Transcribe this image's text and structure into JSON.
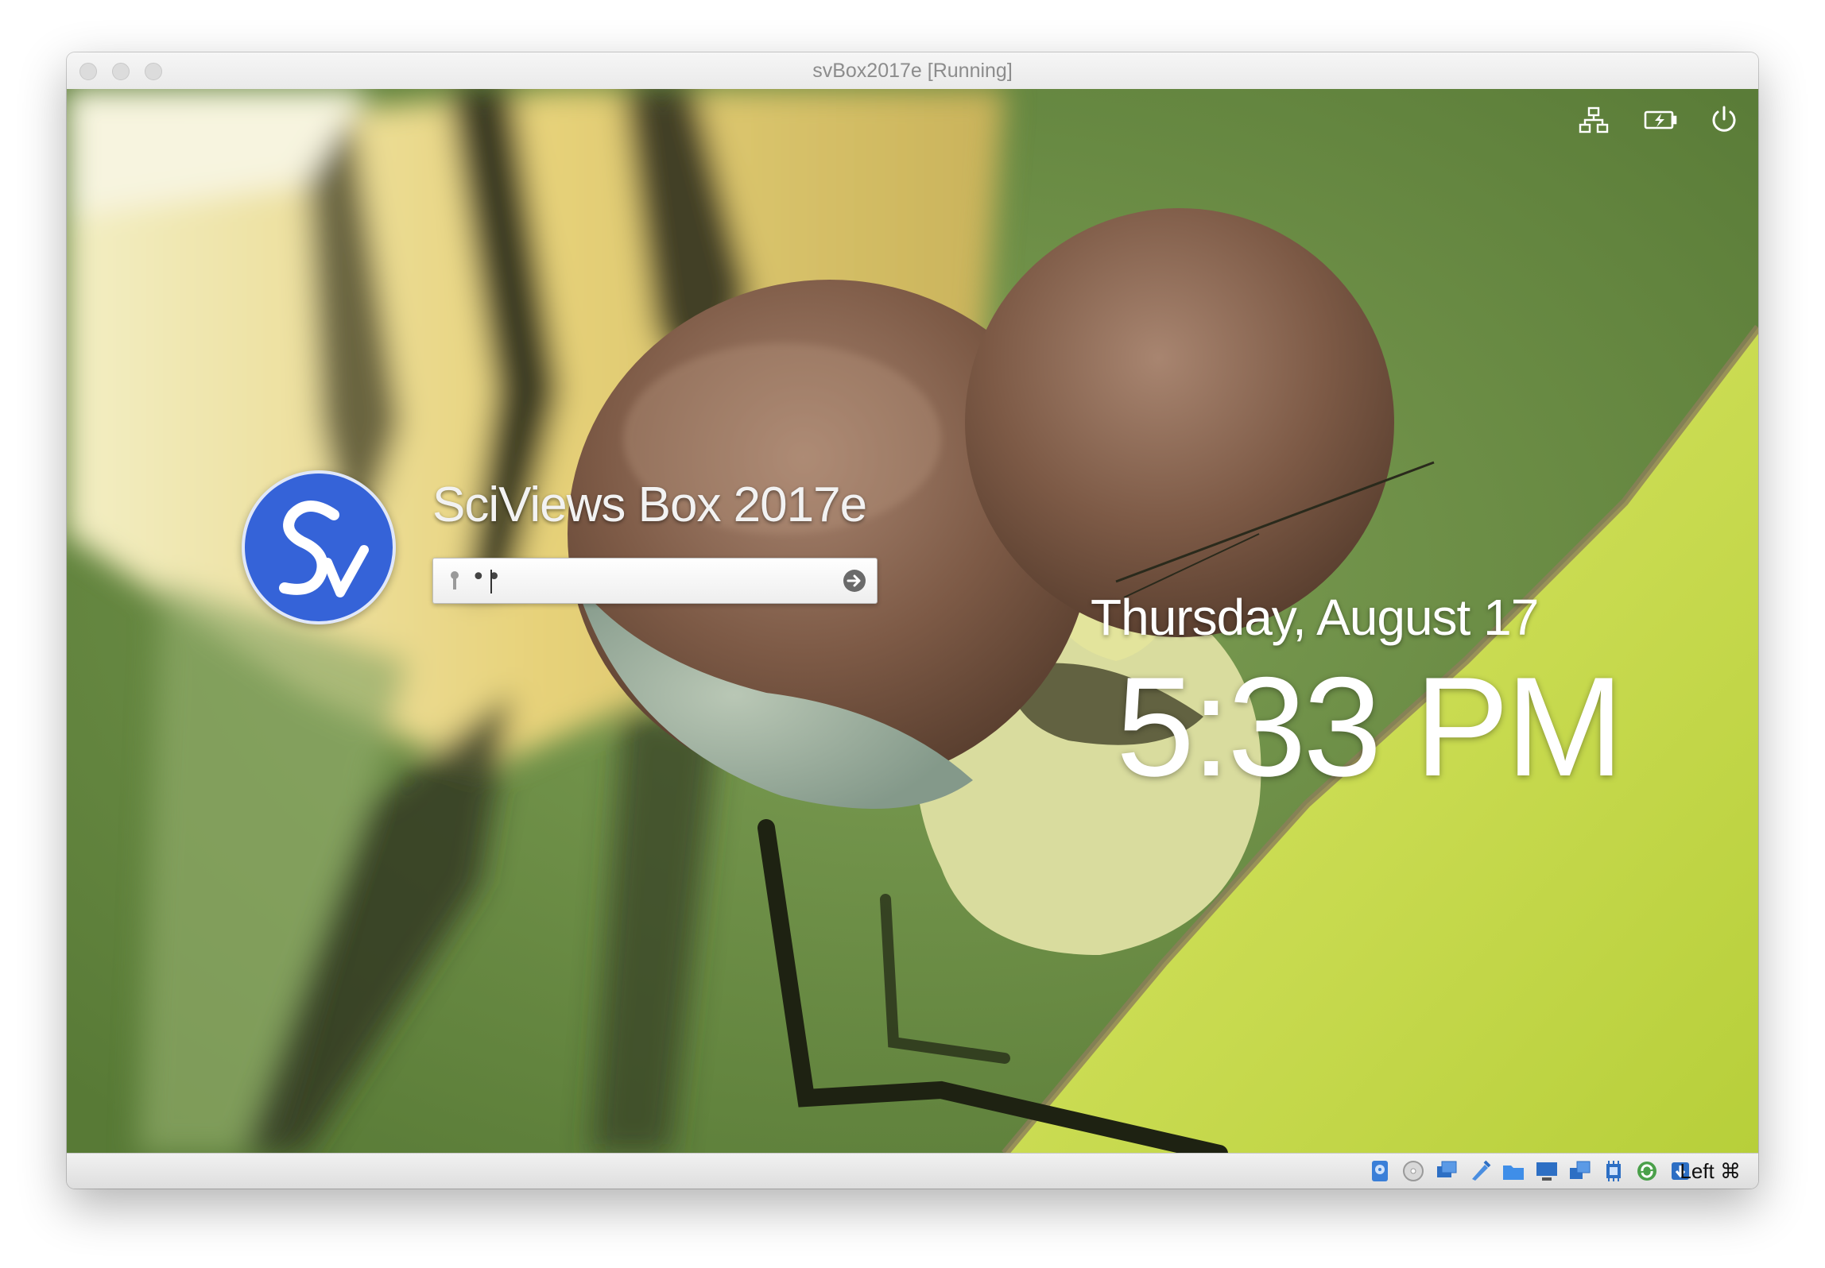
{
  "window": {
    "title": "svBox2017e [Running]"
  },
  "top_panel": {
    "icons": [
      "network-icon",
      "battery-icon",
      "power-icon"
    ]
  },
  "login": {
    "username": "SciViews Box 2017e",
    "avatar_text": "Sv",
    "password_mask": "••"
  },
  "clock": {
    "date": "Thursday, August 17",
    "time": "5:33 PM"
  },
  "statusbar": {
    "icons": [
      "hard-disk-icon",
      "optical-drive-icon",
      "audio-icon",
      "usb-icon",
      "shared-folders-icon",
      "display-icon",
      "video-capture-icon",
      "cpu-icon",
      "network-adapter-icon",
      "mouse-integration-icon"
    ],
    "host_key": "Left ⌘"
  },
  "colors": {
    "avatar_blue": "#3563d8",
    "background_green": "#6f9248"
  }
}
